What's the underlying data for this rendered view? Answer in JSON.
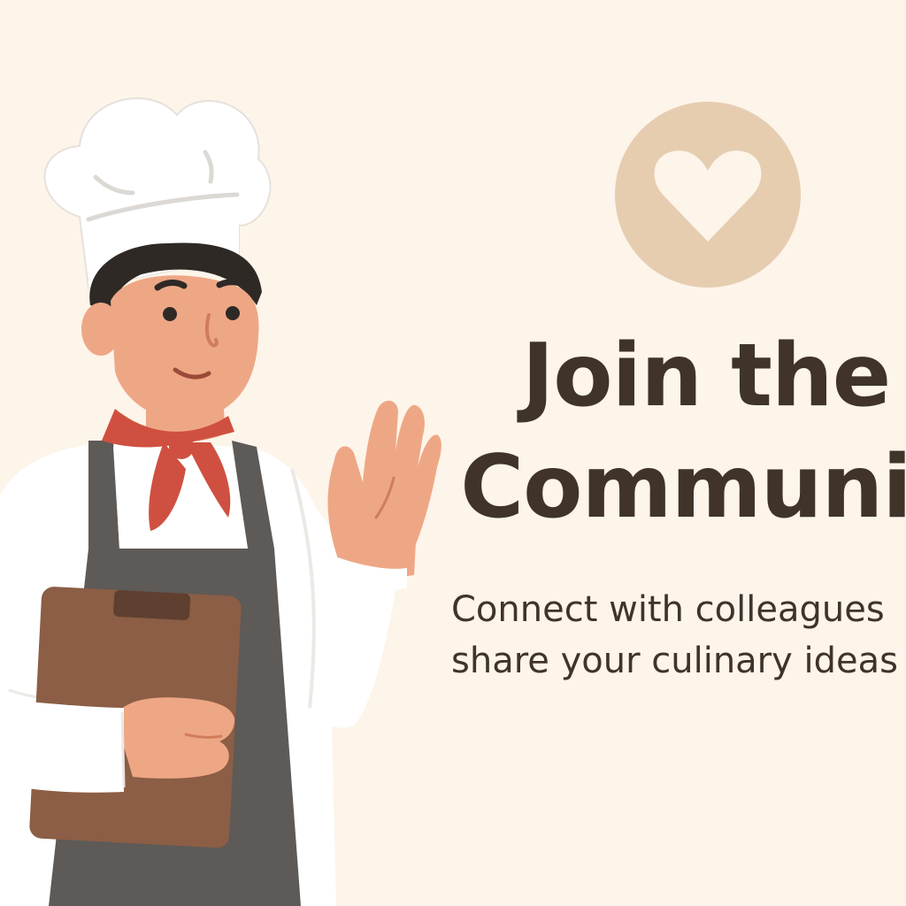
{
  "hero": {
    "headline_line1": "Join the",
    "headline_line2": "Communit",
    "subtitle_line1": "Connect with colleagues",
    "subtitle_line2": "share your culinary ideas"
  },
  "icons": {
    "badge": "heart-icon",
    "figure": "chef-illustration"
  },
  "colors": {
    "background": "#fdf4ea",
    "badge": "#e6cdb0",
    "heart": "#fdf4ea",
    "text": "#3f332a",
    "apron": "#5d5a57",
    "scarf": "#cf5040",
    "clipboard": "#8b5e45",
    "skin": "#eea785"
  }
}
